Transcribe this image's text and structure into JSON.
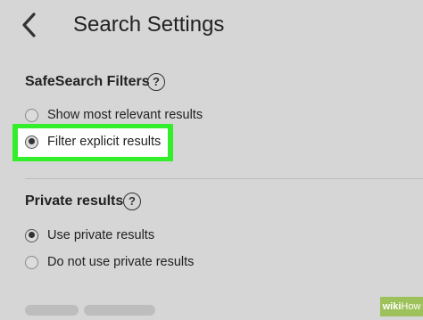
{
  "header": {
    "title": "Search Settings"
  },
  "safesearch": {
    "title": "SafeSearch Filters",
    "options": [
      {
        "label": "Show most relevant results",
        "selected": false
      },
      {
        "label": "Filter explicit results",
        "selected": true
      }
    ]
  },
  "private": {
    "title": "Private results",
    "options": [
      {
        "label": "Use private results",
        "selected": true
      },
      {
        "label": "Do not use private results",
        "selected": false
      }
    ]
  },
  "help_symbol": "?",
  "watermark": {
    "part1": "wiki",
    "part2": "How"
  },
  "colors": {
    "highlight": "#33ee2a",
    "background": "#d6d6d6"
  }
}
